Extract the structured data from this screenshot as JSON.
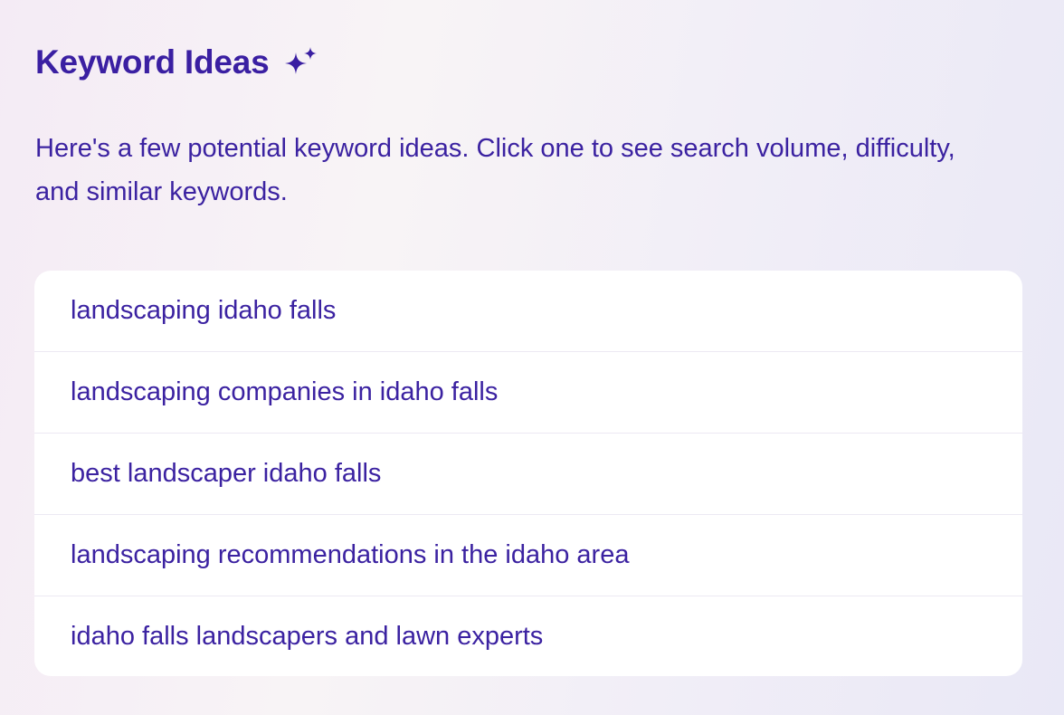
{
  "header": {
    "title": "Keyword Ideas",
    "icon": "sparkle-icon"
  },
  "description": "Here's a few potential keyword ideas. Click one to see search volume, difficulty, and similar keywords.",
  "keywords": [
    "landscaping idaho falls",
    "landscaping companies in idaho falls",
    "best landscaper idaho falls",
    "landscaping recommendations in the idaho area",
    "idaho falls landscapers and lawn experts"
  ],
  "colors": {
    "accent": "#3a1fa2",
    "card_background": "#ffffff",
    "divider": "#ece9f3"
  }
}
